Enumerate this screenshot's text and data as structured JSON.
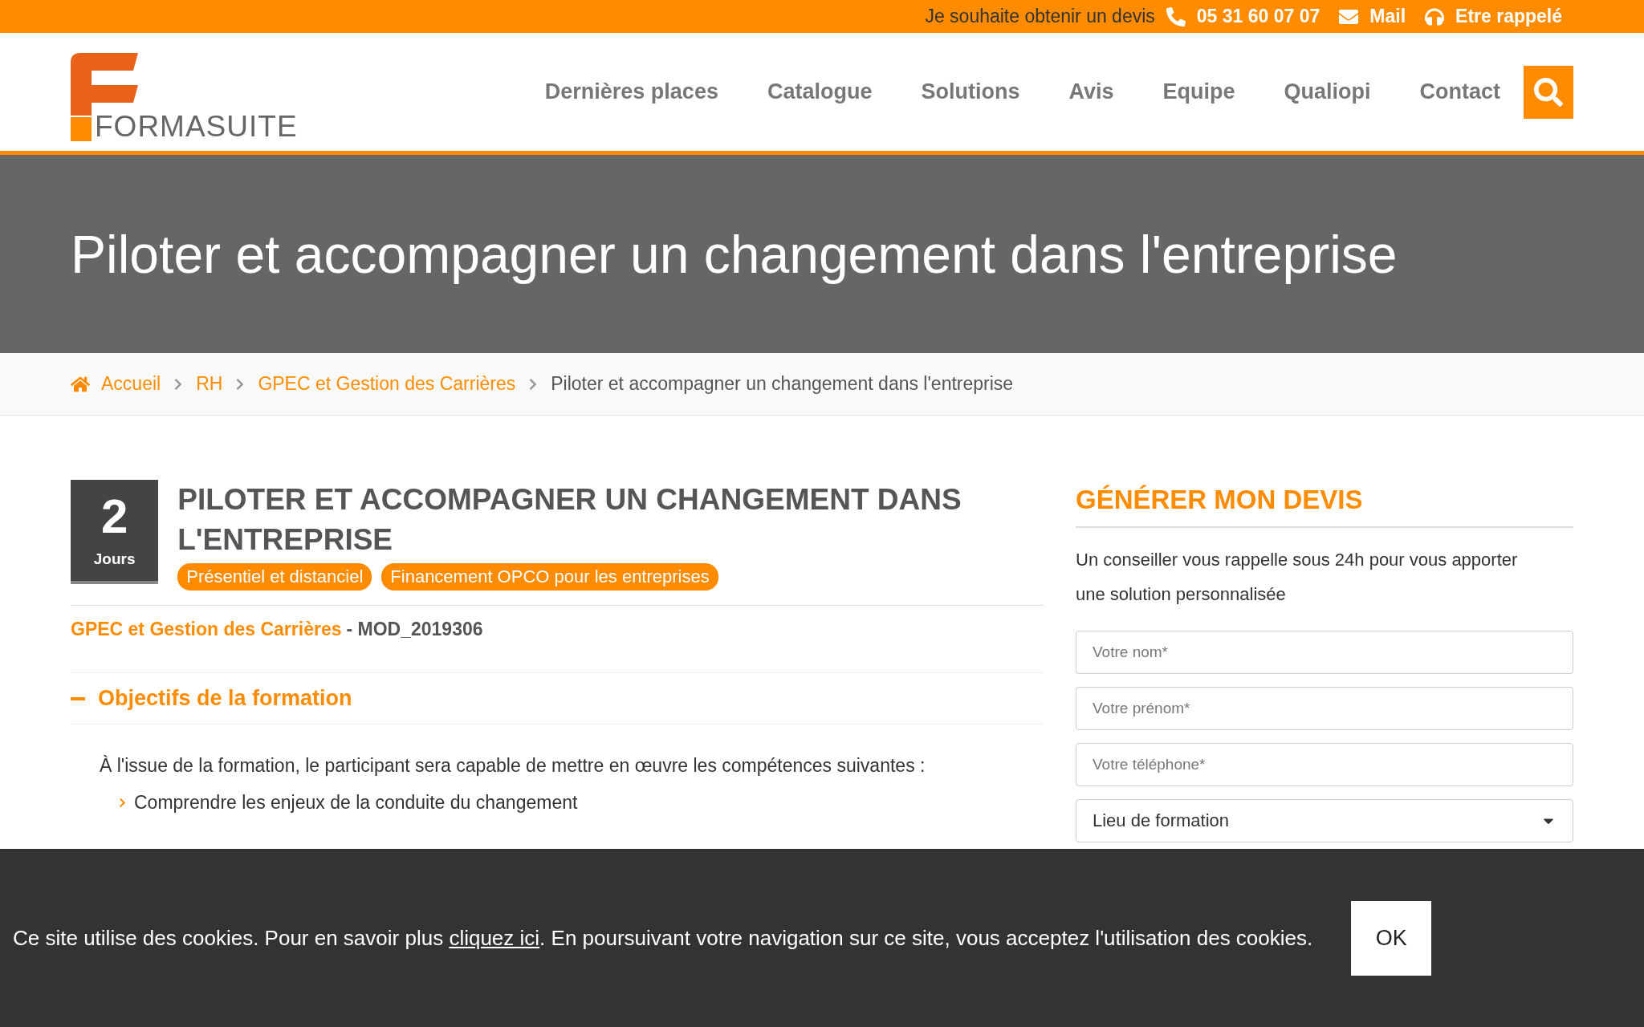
{
  "top_bar": {
    "quote_text": "Je souhaite obtenir un devis",
    "phone": "05 31 60 07 07",
    "mail": "Mail",
    "callback": "Etre rappelé"
  },
  "header": {
    "logo": "FORMASUITE",
    "nav": [
      {
        "label": "Dernières places"
      },
      {
        "label": "Catalogue"
      },
      {
        "label": "Solutions"
      },
      {
        "label": "Avis"
      },
      {
        "label": "Equipe"
      },
      {
        "label": "Qualiopi"
      },
      {
        "label": "Contact"
      }
    ]
  },
  "hero": {
    "title": "Piloter et accompagner un changement dans l'entreprise"
  },
  "breadcrumb": [
    {
      "label": "Accueil",
      "current": false
    },
    {
      "label": "RH",
      "current": false
    },
    {
      "label": "GPEC et Gestion des Carrières",
      "current": false
    },
    {
      "label": "Piloter et accompagner un changement dans l'entreprise",
      "current": true
    }
  ],
  "course": {
    "duration": "2",
    "duration_unit": "Jours",
    "title": "PILOTER ET ACCOMPAGNER UN CHANGEMENT DANS L'ENTREPRISE",
    "tags": [
      "Présentiel et distanciel",
      "Financement OPCO pour les entreprises"
    ],
    "category": "GPEC et Gestion des Carrières",
    "code": "- MOD_2019306",
    "section": {
      "title": "Objectifs de la formation",
      "expanded": true,
      "intro": "À l'issue de la formation, le participant sera capable de mettre en œuvre les compétences suivantes :",
      "items": [
        "Comprendre les enjeux de la conduite du changement"
      ]
    }
  },
  "quote_form": {
    "title": "GÉNÉRER MON DEVIS",
    "text": "Un conseiller vous rappelle sous 24h pour vous apporter une solution personnalisée",
    "fields": [
      {
        "kind": "input",
        "placeholder": "Votre nom*"
      },
      {
        "kind": "input",
        "placeholder": "Votre prénom*"
      },
      {
        "kind": "input",
        "placeholder": "Votre téléphone*"
      },
      {
        "kind": "select",
        "value": "Lieu de formation"
      }
    ]
  },
  "cookie_banner": {
    "text_before": "Ce site utilise des cookies. Pour en savoir plus ",
    "link": "cliquez ici",
    "text_after": ". En poursuivant votre navigation sur ce site, vous acceptez l'utilisation des cookies.",
    "button": "OK"
  }
}
